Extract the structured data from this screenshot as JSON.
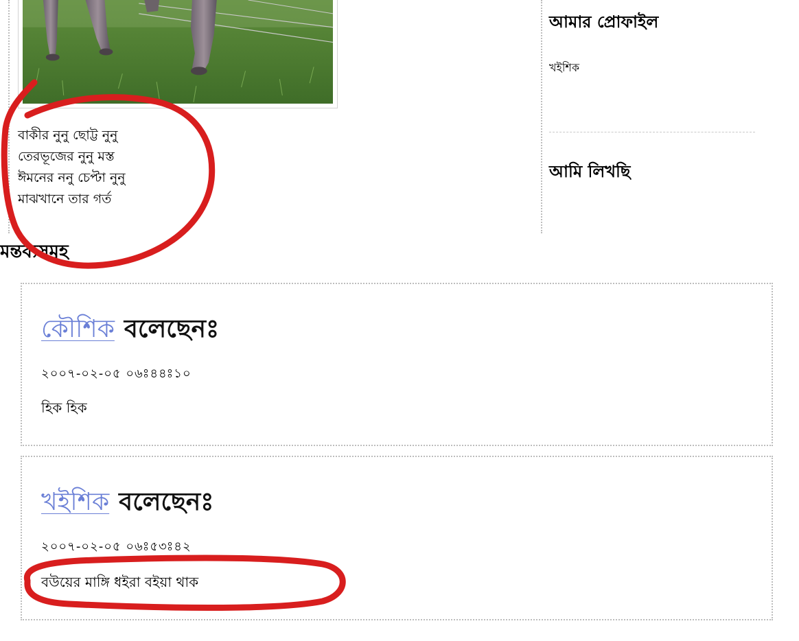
{
  "post": {
    "image_alt": "photo of animal legs standing on grass",
    "poem": [
      "বাকীর নুনু ছোট্ট নুনু",
      "তেরভূজের নুনু মস্ত",
      "ঈমনের ননু চেপ্টা নুনু",
      "মাঝখানে তার গর্ত"
    ]
  },
  "sidebar": {
    "profile_heading": "আমার প্রোফাইল",
    "profile_name": "খইশিক",
    "writing_heading": "আমি লিখছি"
  },
  "comments": {
    "heading": "মন্তব্যসমূহ",
    "items": [
      {
        "author": "কৌশিক",
        "said": "বলেছেনঃ",
        "timestamp": "২০০৭-০২-০৫ ০৬ঃ৪৪ঃ১০",
        "text": "হিক হিক"
      },
      {
        "author": "খইশিক",
        "said": "বলেছেনঃ",
        "timestamp": "২০০৭-০২-০৫ ০৬ঃ৫৩ঃ৪২",
        "text": "বউয়ের মাঙ্গি ধইরা বইয়া থাক"
      }
    ]
  },
  "colors": {
    "author_link": "#6a7fd6",
    "annotation": "#d81e1e",
    "dotted_border": "#bdbdbd"
  }
}
